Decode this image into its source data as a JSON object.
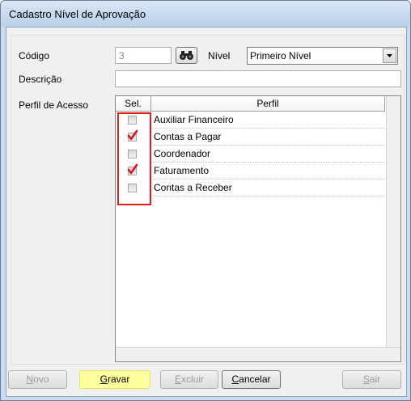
{
  "window": {
    "title": "Cadastro Nível de Aprovação"
  },
  "form": {
    "codigo_label": "Código",
    "codigo_value": "3",
    "nivel_label": "Nível",
    "nivel_value": "Primeiro Nível",
    "descricao_label": "Descrição",
    "descricao_value": "",
    "perfil_label": "Perfil de Acesso"
  },
  "grid": {
    "headers": {
      "sel": "Sel.",
      "perfil": "Perfil"
    },
    "rows": [
      {
        "perfil": "Auxiliar Financeiro",
        "selected": false
      },
      {
        "perfil": "Contas a Pagar",
        "selected": true
      },
      {
        "perfil": "Coordenador",
        "selected": false
      },
      {
        "perfil": "Faturamento",
        "selected": true
      },
      {
        "perfil": "Contas a Receber",
        "selected": false
      }
    ]
  },
  "buttons": {
    "novo": {
      "first": "N",
      "rest": "ovo"
    },
    "gravar": {
      "first": "G",
      "rest": "ravar"
    },
    "excluir": {
      "first": "E",
      "rest": "xcluir"
    },
    "cancelar": {
      "first": "C",
      "rest": "ancelar"
    },
    "sair": {
      "first": "S",
      "rest": "air"
    }
  },
  "colors": {
    "highlight": "#ffff9e",
    "annotation_border": "#e0201a",
    "check": "#d9151d"
  }
}
